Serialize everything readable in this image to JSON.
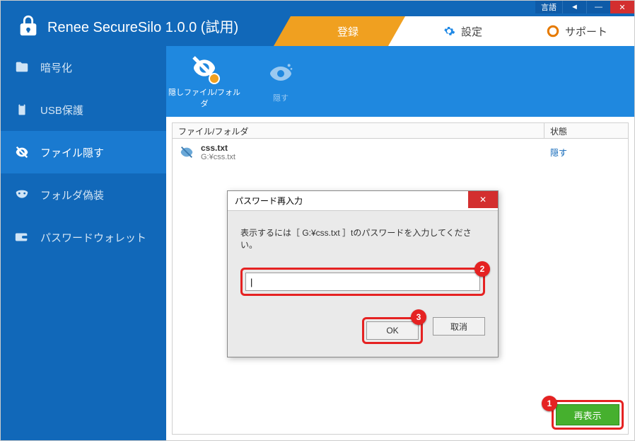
{
  "topbar": {
    "language_label": "言語",
    "nav_icon": "◄",
    "minimize_icon": "—",
    "close_icon": "✕"
  },
  "header": {
    "title": "Renee SecureSilo 1.0.0 (試用)"
  },
  "ribbon": {
    "register": "登録",
    "settings": "設定",
    "support": "サポート"
  },
  "sidebar": {
    "items": [
      {
        "label": "暗号化"
      },
      {
        "label": "USB保護"
      },
      {
        "label": "ファイル隠す"
      },
      {
        "label": "フォルダ偽装"
      },
      {
        "label": "パスワードウォレット"
      }
    ]
  },
  "toolbar": {
    "hidefile_label": "隠しファイル/フォルダ",
    "hide_label": "隠す"
  },
  "list": {
    "header_file": "ファイル/フォルダ",
    "header_state": "状態",
    "rows": [
      {
        "name": "css.txt",
        "path": "G:¥css.txt",
        "state": "隠す"
      }
    ]
  },
  "dialog": {
    "title": "パスワード再入力",
    "message": "表示するには［ G:¥css.txt ］tのパスワードを入力してください。",
    "password_value": "|",
    "ok_label": "OK",
    "cancel_label": "取消",
    "close_icon": "✕"
  },
  "reshow": {
    "label": "再表示"
  },
  "callouts": {
    "one": "1",
    "two": "2",
    "three": "3"
  },
  "colors": {
    "primary": "#1168b9",
    "accent": "#f0a020",
    "toolbar": "#1f88df",
    "danger": "#e52222",
    "success": "#46b02e"
  }
}
